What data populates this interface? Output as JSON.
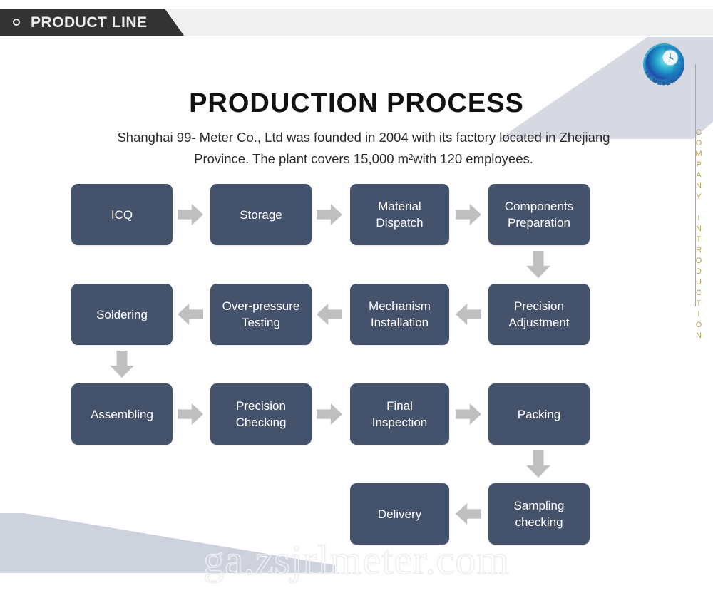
{
  "header": {
    "tab_label": "PRODUCT LINE",
    "bullet_icon": "circle-outline-icon"
  },
  "brand": {
    "logo_icon": "99-meter-spiral-logo",
    "logo_text": "99 METER",
    "vertical_label": "COMPANY INTRODUCTION"
  },
  "main": {
    "title": "PRODUCTION PROCESS",
    "intro": "Shanghai 99- Meter Co., Ltd was founded in 2004 with its factory located in Zhejiang Province. The plant covers 15,000 m²with 120 employees."
  },
  "colors": {
    "box_fill": "#44536b",
    "arrow_fill": "#bfbfbf",
    "header_dark": "#333333",
    "header_light": "#f0f0f0",
    "gold": "#c9a94e",
    "deco_blue": "#d6d9e2"
  },
  "flow": {
    "boxes": [
      {
        "id": "icq",
        "label": "ICQ"
      },
      {
        "id": "storage",
        "label": "Storage"
      },
      {
        "id": "material-dispatch",
        "label": "Material\nDispatch"
      },
      {
        "id": "components-preparation",
        "label": "Components\nPreparation"
      },
      {
        "id": "precision-adjustment",
        "label": "Precision\nAdjustment"
      },
      {
        "id": "mechanism-installation",
        "label": "Mechanism\nInstallation"
      },
      {
        "id": "over-pressure-testing",
        "label": "Over-pressure\nTesting"
      },
      {
        "id": "soldering",
        "label": "Soldering"
      },
      {
        "id": "assembling",
        "label": "Assembling"
      },
      {
        "id": "precision-checking",
        "label": "Precision\nChecking"
      },
      {
        "id": "final-inspection",
        "label": "Final\nInspection"
      },
      {
        "id": "packing",
        "label": "Packing"
      },
      {
        "id": "sampling-checking",
        "label": "Sampling\nchecking"
      },
      {
        "id": "delivery",
        "label": "Delivery"
      }
    ],
    "arrows": [
      {
        "id": "icq-to-storage",
        "direction": "right"
      },
      {
        "id": "storage-to-material-dispatch",
        "direction": "right"
      },
      {
        "id": "material-dispatch-to-components-preparation",
        "direction": "right"
      },
      {
        "id": "components-preparation-to-precision-adjustment",
        "direction": "down"
      },
      {
        "id": "precision-adjustment-to-mechanism-installation",
        "direction": "left"
      },
      {
        "id": "mechanism-installation-to-over-pressure-testing",
        "direction": "left"
      },
      {
        "id": "over-pressure-testing-to-soldering",
        "direction": "left"
      },
      {
        "id": "soldering-to-assembling",
        "direction": "down"
      },
      {
        "id": "assembling-to-precision-checking",
        "direction": "right"
      },
      {
        "id": "precision-checking-to-final-inspection",
        "direction": "right"
      },
      {
        "id": "final-inspection-to-packing",
        "direction": "right"
      },
      {
        "id": "packing-to-sampling-checking",
        "direction": "down"
      },
      {
        "id": "sampling-checking-to-delivery",
        "direction": "left"
      }
    ]
  },
  "watermark": {
    "text": "ga.zsjrlmeter.com"
  }
}
